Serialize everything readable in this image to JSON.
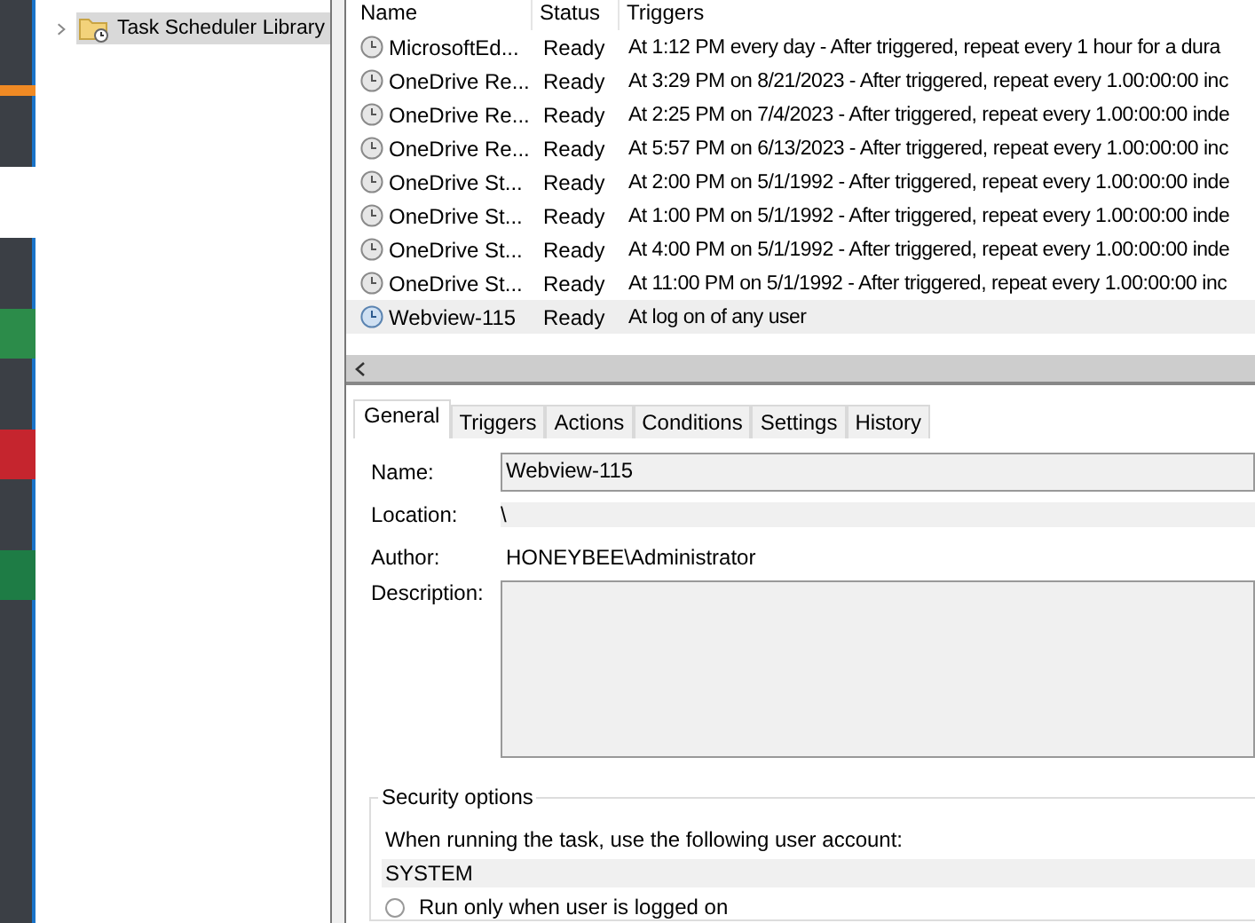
{
  "tree": {
    "items": [
      {
        "label": "Task Scheduler Library",
        "selected": true,
        "expanded": false
      }
    ]
  },
  "task_list": {
    "columns": [
      "Name",
      "Status",
      "Triggers"
    ],
    "rows": [
      {
        "name": "MicrosoftEd...",
        "status": "Ready",
        "trigger": "At 1:12 PM every day - After triggered, repeat every 1 hour for a dura",
        "selected": false
      },
      {
        "name": "OneDrive Re...",
        "status": "Ready",
        "trigger": "At 3:29 PM on 8/21/2023 - After triggered, repeat every 1.00:00:00 inc",
        "selected": false
      },
      {
        "name": "OneDrive Re...",
        "status": "Ready",
        "trigger": "At 2:25 PM on 7/4/2023 - After triggered, repeat every 1.00:00:00 inde",
        "selected": false
      },
      {
        "name": "OneDrive Re...",
        "status": "Ready",
        "trigger": "At 5:57 PM on 6/13/2023 - After triggered, repeat every 1.00:00:00 inc",
        "selected": false
      },
      {
        "name": "OneDrive St...",
        "status": "Ready",
        "trigger": "At 2:00 PM on 5/1/1992 - After triggered, repeat every 1.00:00:00 inde",
        "selected": false
      },
      {
        "name": "OneDrive St...",
        "status": "Ready",
        "trigger": "At 1:00 PM on 5/1/1992 - After triggered, repeat every 1.00:00:00 inde",
        "selected": false
      },
      {
        "name": "OneDrive St...",
        "status": "Ready",
        "trigger": "At 4:00 PM on 5/1/1992 - After triggered, repeat every 1.00:00:00 inde",
        "selected": false
      },
      {
        "name": "OneDrive St...",
        "status": "Ready",
        "trigger": "At 11:00 PM on 5/1/1992 - After triggered, repeat every 1.00:00:00 inc",
        "selected": false
      },
      {
        "name": "Webview-115",
        "status": "Ready",
        "trigger": "At log on of any user",
        "selected": true
      }
    ]
  },
  "tabs": [
    {
      "label": "General",
      "selected": true
    },
    {
      "label": "Triggers",
      "selected": false
    },
    {
      "label": "Actions",
      "selected": false
    },
    {
      "label": "Conditions",
      "selected": false
    },
    {
      "label": "Settings",
      "selected": false
    },
    {
      "label": "History",
      "selected": false
    }
  ],
  "general": {
    "name_label": "Name:",
    "name_value": "Webview-115",
    "location_label": "Location:",
    "location_value": "\\",
    "author_label": "Author:",
    "author_value": "HONEYBEE\\Administrator",
    "description_label": "Description:",
    "security": {
      "title": "Security options",
      "account_label": "When running the task, use the following user account:",
      "account_value": "SYSTEM",
      "options": [
        {
          "label": "Run only when user is logged on",
          "checked": false
        }
      ]
    }
  }
}
